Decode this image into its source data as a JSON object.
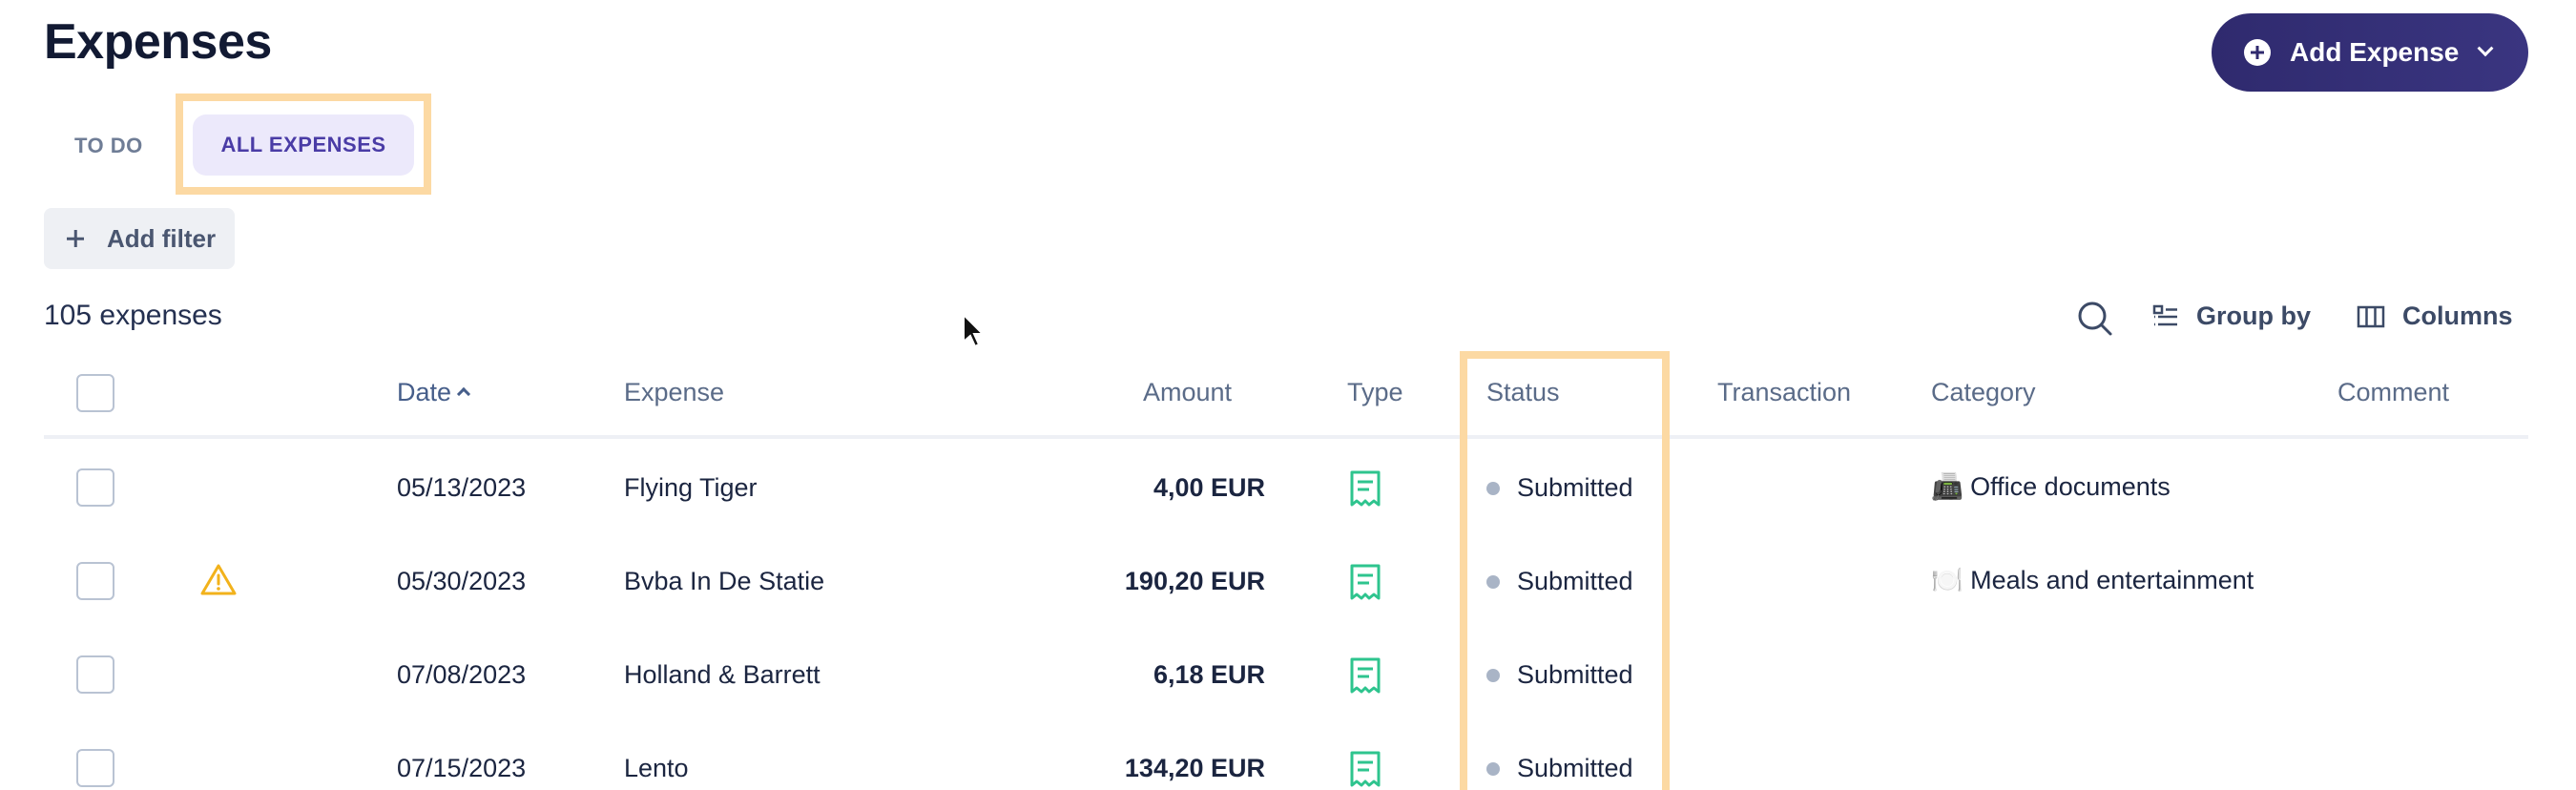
{
  "page": {
    "title": "Expenses"
  },
  "actions": {
    "add_expense_label": "Add Expense"
  },
  "tabs": [
    {
      "label": "TO DO",
      "active": false
    },
    {
      "label": "ALL EXPENSES",
      "active": true
    }
  ],
  "filters": {
    "add_filter_label": "Add filter"
  },
  "summary": {
    "count_text": "105 expenses"
  },
  "toolbar": {
    "group_by_label": "Group by",
    "columns_label": "Columns"
  },
  "table": {
    "headers": {
      "date": "Date",
      "expense": "Expense",
      "amount": "Amount",
      "type": "Type",
      "status": "Status",
      "transaction": "Transaction",
      "category": "Category",
      "comment": "Comment"
    },
    "sort": {
      "column": "date",
      "direction": "ascending"
    },
    "rows": [
      {
        "warning": false,
        "date": "05/13/2023",
        "expense": "Flying Tiger",
        "amount": "4,00 EUR",
        "type": "receipt-icon",
        "status": "Submitted",
        "category_emoji": "📠",
        "category": "Office documents"
      },
      {
        "warning": true,
        "date": "05/30/2023",
        "expense": "Bvba In De Statie",
        "amount": "190,20 EUR",
        "type": "receipt-icon",
        "status": "Submitted",
        "category_emoji": "🍽️",
        "category": "Meals and entertainment"
      },
      {
        "warning": false,
        "date": "07/08/2023",
        "expense": "Holland & Barrett",
        "amount": "6,18 EUR",
        "type": "receipt-icon",
        "status": "Submitted",
        "category_emoji": "",
        "category": ""
      },
      {
        "warning": false,
        "date": "07/15/2023",
        "expense": "Lento",
        "amount": "134,20 EUR",
        "type": "receipt-icon",
        "status": "Submitted",
        "category_emoji": "",
        "category": ""
      }
    ]
  },
  "colors": {
    "primary_button": "#2f2a6e",
    "active_tab_bg": "#ece9fb",
    "active_tab_text": "#4a3ca6",
    "highlight": "#fcd9a3",
    "receipt_icon": "#2ec48e",
    "warning_icon": "#f2b21b",
    "status_dot": "#a9b4c6"
  }
}
